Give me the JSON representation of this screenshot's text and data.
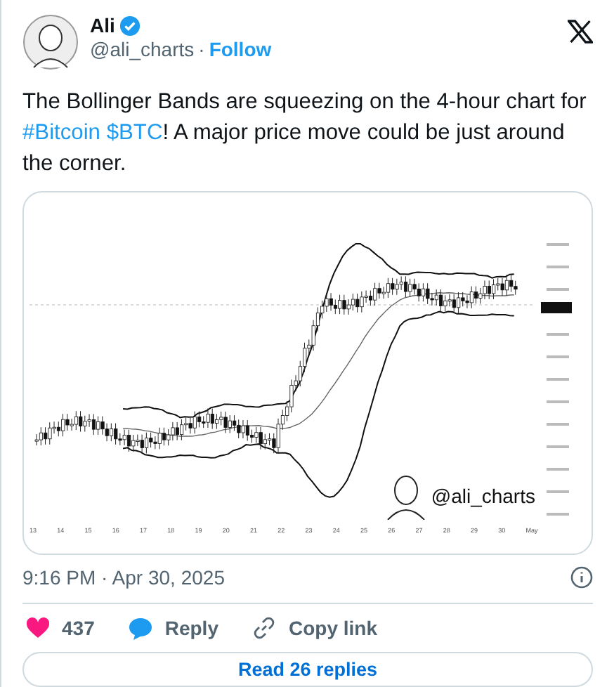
{
  "author": {
    "name": "Ali",
    "verified": true,
    "handle": "@ali_charts",
    "separator": "·",
    "follow": "Follow"
  },
  "text_parts": [
    {
      "kind": "plain",
      "text": "The Bollinger Bands are squeezing on the 4-hour chart for "
    },
    {
      "kind": "link",
      "text": "#Bitcoin"
    },
    {
      "kind": "link",
      "text": "$BTC"
    },
    {
      "kind": "plain",
      "text": "! A major price move could be just around the corner."
    }
  ],
  "chart_image": {
    "x_labels": [
      "13",
      "14",
      "15",
      "16",
      "17",
      "18",
      "19",
      "20",
      "21",
      "22",
      "23",
      "24",
      "25",
      "26",
      "27",
      "28",
      "29",
      "30",
      "May"
    ],
    "overlay_handle": "@ali_charts"
  },
  "timestamp": "9:16 PM · Apr 30, 2025",
  "actions": [
    {
      "kind": "like",
      "label": "437"
    },
    {
      "kind": "reply",
      "label": "Reply"
    },
    {
      "kind": "copy",
      "label": "Copy link"
    }
  ],
  "read_replies": "Read 26 replies"
}
